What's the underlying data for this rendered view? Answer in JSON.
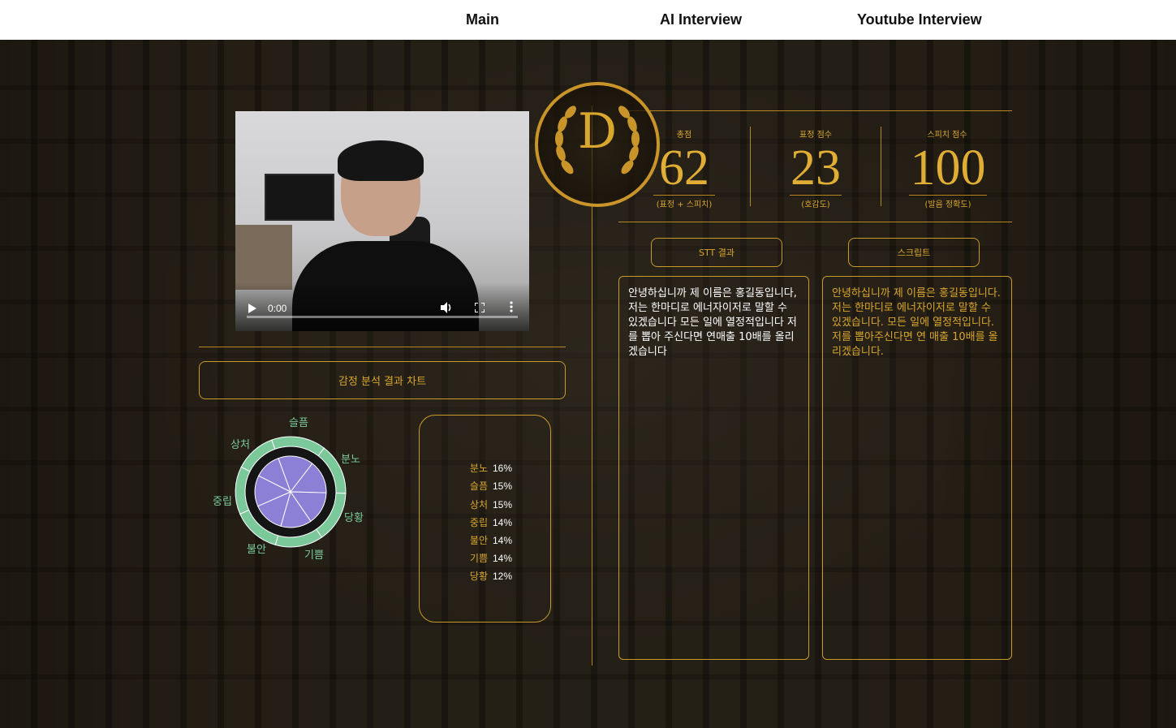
{
  "nav": {
    "items": [
      "Main",
      "AI Interview",
      "Youtube Interview"
    ]
  },
  "video": {
    "time": "0:00",
    "progress": 0
  },
  "emotion": {
    "section_title": "감정 분석 결과 차트",
    "chart_labels": [
      "슬픔",
      "분노",
      "당황",
      "기쁨",
      "불안",
      "중립",
      "상처"
    ],
    "list": [
      {
        "name": "분노",
        "pct": "16%"
      },
      {
        "name": "슬픔",
        "pct": "15%"
      },
      {
        "name": "상처",
        "pct": "15%"
      },
      {
        "name": "중립",
        "pct": "14%"
      },
      {
        "name": "불안",
        "pct": "14%"
      },
      {
        "name": "기쁨",
        "pct": "14%"
      },
      {
        "name": "당황",
        "pct": "12%"
      }
    ]
  },
  "chart_data": {
    "type": "pie",
    "categories": [
      "분노",
      "슬픔",
      "상처",
      "중립",
      "불안",
      "기쁨",
      "당황"
    ],
    "values": [
      16,
      15,
      15,
      14,
      14,
      14,
      12
    ],
    "colors": {
      "inner": "#8b80d6",
      "ring": "#7bc99b",
      "text": "#7bc99b"
    }
  },
  "medal": {
    "letter": "D"
  },
  "scores": [
    {
      "label": "총점",
      "value": "62",
      "sub": "(표정 + 스피치)"
    },
    {
      "label": "표정 점수",
      "value": "23",
      "sub": "(호감도)"
    },
    {
      "label": "스피치 점수",
      "value": "100",
      "sub": "(발음 정확도)"
    }
  ],
  "tabs": {
    "stt": "STT 결과",
    "script": "스크립트"
  },
  "stt_text": "안녕하십니까 제 이름은 홍길동입니다, 저는 한마디로 에너자이저로 말할 수 있겠습니다 모든 일에 열정적입니다 저를 뽑아 주신다면 연매출 10배를 올리겠습니다",
  "script_text": "안녕하십니까 제 이름은 홍길동입니다. 저는 한마디로 에너자이저로 말할 수 있겠습니다. 모든 일에 열정적입니다. 저를 뽑아주신다면 연 매출 10배를 올리겠습니다.",
  "colors": {
    "gold": "#d9a62e",
    "pie_inner": "#8b80d6",
    "pie_ring": "#7bc99b"
  }
}
